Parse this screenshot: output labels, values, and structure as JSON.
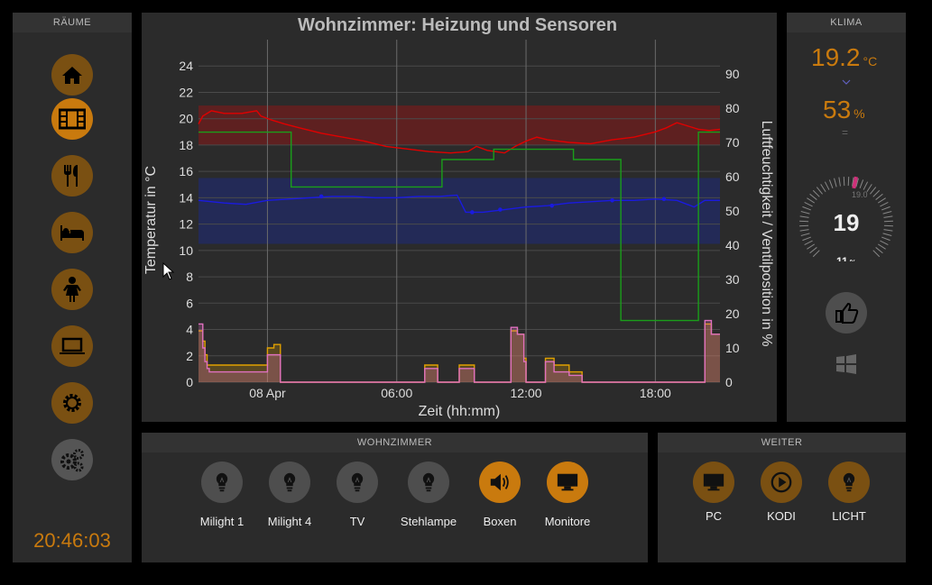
{
  "rooms": {
    "title": "RÄUME",
    "clock": "20:46:03",
    "items": [
      {
        "icon": "home-icon",
        "style": "brown"
      },
      {
        "icon": "film-icon",
        "style": "orange"
      },
      {
        "icon": "dining-icon",
        "style": "brown"
      },
      {
        "icon": "bed-icon",
        "style": "brown"
      },
      {
        "icon": "child-icon",
        "style": "brown"
      },
      {
        "icon": "laptop-icon",
        "style": "brown"
      },
      {
        "icon": "gear-icon",
        "style": "brown"
      },
      {
        "icon": "gears-icon",
        "style": "grey"
      }
    ]
  },
  "klima": {
    "title": "KLIMA",
    "temperature": "19.2",
    "temperature_unit": "°C",
    "humidity": "53",
    "humidity_unit": "%",
    "humidity_trend": "=",
    "gauge_value": "19",
    "gauge_setpoint": "19.0",
    "gauge_valve": "11",
    "gauge_valve_unit": "%"
  },
  "wohnzimmer": {
    "title": "WOHNZIMMER",
    "buttons": [
      {
        "label": "Milight 1",
        "icon": "bulb-icon",
        "style": "grey"
      },
      {
        "label": "Milight 4",
        "icon": "bulb-icon",
        "style": "grey"
      },
      {
        "label": "TV",
        "icon": "bulb-icon",
        "style": "grey"
      },
      {
        "label": "Stehlampe",
        "icon": "bulb-icon",
        "style": "grey"
      },
      {
        "label": "Boxen",
        "icon": "speaker-icon",
        "style": "orange"
      },
      {
        "label": "Monitore",
        "icon": "monitor-icon",
        "style": "orange"
      }
    ]
  },
  "weiter": {
    "title": "WEITER",
    "buttons": [
      {
        "label": "PC",
        "icon": "monitor-icon",
        "style": "brown"
      },
      {
        "label": "KODI",
        "icon": "play-icon",
        "style": "brown"
      },
      {
        "label": "LICHT",
        "icon": "bulb-icon",
        "style": "brown"
      }
    ]
  },
  "chart_data": {
    "type": "line",
    "title": "Wohnzimmer: Heizung und Sensoren",
    "xlabel": "Zeit (hh:mm)",
    "ylabel": "Temperatur in °C",
    "ylabel_right": "Luftfeuchtigkeit / Ventilposition in %",
    "ylim": [
      0,
      26
    ],
    "ylim_right": [
      0,
      100
    ],
    "yticks": [
      "0",
      "2",
      "4",
      "6",
      "8",
      "10",
      "12",
      "14",
      "16",
      "18",
      "20",
      "22",
      "24"
    ],
    "yticks_right": [
      "0",
      "10",
      "20",
      "30",
      "40",
      "50",
      "60",
      "70",
      "80",
      "90"
    ],
    "xticks": [
      "08 Apr",
      "06:00",
      "12:00",
      "18:00"
    ],
    "xrange_hours": [
      -3.2,
      21.0
    ],
    "xtick_hours": [
      0,
      6,
      12,
      18
    ],
    "grid": true,
    "bands": [
      {
        "from": 18,
        "to": 21,
        "color": "#7a1a1a",
        "axis": "left"
      },
      {
        "from": 10.5,
        "to": 15.5,
        "color": "#1e2a6e",
        "axis": "left"
      }
    ],
    "series": [
      {
        "color": "#e00000",
        "axis": "left",
        "step": false,
        "x": [
          -3.2,
          -3.0,
          -2.6,
          -2.0,
          -1.2,
          -0.5,
          -0.3,
          0.2,
          0.8,
          1.5,
          2.5,
          3.5,
          4.5,
          5.5,
          6.5,
          7.5,
          8.5,
          9.3,
          9.7,
          10.2,
          11.0,
          11.5,
          12.0,
          12.5,
          13.0,
          14.0,
          15.0,
          16.0,
          17.0,
          18.0,
          18.5,
          19.0,
          19.4,
          20.0,
          20.5,
          21.0
        ],
        "y": [
          19.6,
          20.2,
          20.6,
          20.4,
          20.4,
          20.6,
          20.2,
          19.9,
          19.6,
          19.3,
          18.9,
          18.6,
          18.3,
          17.9,
          17.7,
          17.5,
          17.4,
          17.5,
          17.9,
          17.6,
          17.4,
          17.9,
          18.3,
          18.6,
          18.4,
          18.2,
          18.1,
          18.4,
          18.6,
          19.0,
          19.3,
          19.7,
          19.5,
          19.2,
          19.1,
          19.2
        ]
      },
      {
        "color": "#1a1ae0",
        "axis": "left",
        "step": false,
        "x": [
          -3.2,
          -2.0,
          -1.0,
          0.0,
          1.0,
          2.0,
          3.0,
          4.0,
          5.0,
          6.0,
          7.0,
          8.0,
          8.8,
          9.2,
          10.0,
          11.0,
          12.0,
          13.0,
          14.0,
          15.0,
          16.0,
          17.0,
          18.0,
          19.0,
          19.8,
          20.3,
          21.0
        ],
        "y": [
          13.8,
          13.6,
          13.5,
          13.8,
          13.9,
          14.0,
          14.1,
          14.1,
          14.0,
          14.0,
          14.1,
          14.1,
          14.2,
          12.9,
          12.9,
          13.1,
          13.3,
          13.4,
          13.6,
          13.7,
          13.8,
          13.8,
          13.9,
          13.8,
          13.3,
          13.8,
          13.8
        ]
      },
      {
        "color": "#1a9e1a",
        "axis": "right",
        "step": true,
        "x": [
          -3.2,
          0.8,
          1.1,
          7.6,
          8.1,
          10.3,
          10.5,
          13.8,
          14.2,
          16.0,
          16.4,
          19.5,
          20.0,
          21.0
        ],
        "y": [
          73,
          73,
          57,
          57,
          65,
          65,
          68,
          68,
          65,
          65,
          18,
          18,
          73,
          73
        ]
      },
      {
        "color": "#e0a000",
        "axis": "right",
        "step": true,
        "fill": true,
        "x": [
          -3.2,
          -3.0,
          -2.9,
          -2.8,
          -2.7,
          -2.6,
          -2.5,
          -2.4,
          -2.3,
          -2.2,
          -2.1,
          -2.0,
          -1.8,
          0.0,
          0.3,
          0.6,
          0.9,
          6.5,
          7.3,
          7.9,
          8.9,
          9.6,
          11.3,
          11.6,
          11.9,
          12.0,
          12.4,
          12.9,
          13.3,
          14.0,
          14.6,
          19.8,
          20.3,
          20.6,
          21.0
        ],
        "y": [
          15,
          12,
          8,
          5,
          5,
          5,
          5,
          5,
          5,
          5,
          5,
          5,
          5,
          10,
          11,
          0,
          0,
          0,
          5,
          0,
          5,
          0,
          15,
          14,
          7,
          0,
          0,
          7,
          5,
          3,
          0,
          0,
          17,
          14,
          14
        ]
      },
      {
        "color": "#e070c0",
        "axis": "right",
        "step": true,
        "fill": true,
        "x": [
          -3.2,
          -3.0,
          -2.9,
          -2.8,
          -2.7,
          -2.6,
          -2.5,
          -2.4,
          -2.3,
          -2.2,
          -2.1,
          -2.0,
          -1.8,
          0.0,
          0.3,
          0.6,
          0.9,
          6.5,
          7.3,
          7.9,
          8.9,
          9.6,
          11.3,
          11.6,
          11.9,
          12.0,
          12.4,
          12.9,
          13.3,
          14.0,
          14.6,
          19.8,
          20.3,
          20.6,
          21.0
        ],
        "y": [
          17,
          10,
          6,
          4,
          3,
          3,
          3,
          3,
          3,
          3,
          3,
          3,
          3,
          8,
          8,
          0,
          0,
          0,
          4,
          0,
          4,
          0,
          16,
          14,
          6,
          0,
          0,
          6,
          3,
          2,
          0,
          0,
          18,
          14,
          14
        ]
      }
    ]
  }
}
